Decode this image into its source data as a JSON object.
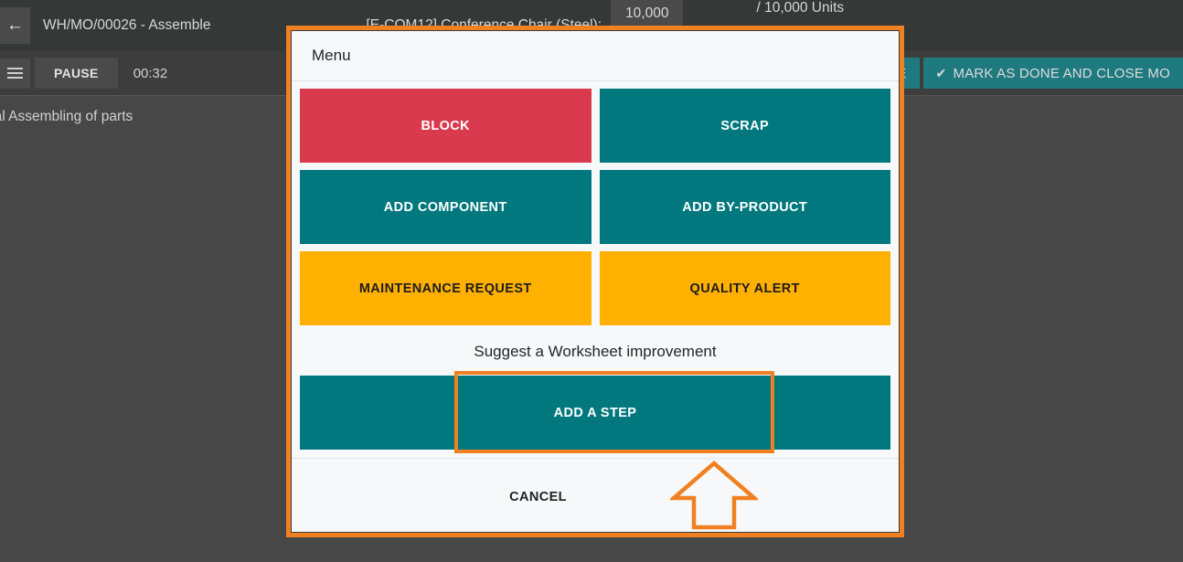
{
  "topbar": {
    "back_icon": "arrow-left-icon",
    "title": "WH/MO/00026 - Assemble",
    "product": "[E-COM12] Conference Chair (Steel):",
    "quantity": "10,000",
    "quantity_suffix": "/ 10,000 Units"
  },
  "subbar": {
    "menu_icon": "hamburger-menu-icon",
    "pause_label": "PAUSE",
    "timer": "00:32",
    "done_label": "DONE",
    "mark_done_close_label": "MARK AS DONE AND CLOSE MO",
    "check_icon": "check-icon"
  },
  "content": {
    "step_description": "nal Assembling of parts"
  },
  "modal": {
    "title": "Menu",
    "buttons": [
      {
        "label": "BLOCK",
        "style": "red",
        "name": "block-button"
      },
      {
        "label": "SCRAP",
        "style": "teal",
        "name": "scrap-button"
      },
      {
        "label": "ADD COMPONENT",
        "style": "teal",
        "name": "add-component-button"
      },
      {
        "label": "ADD BY-PRODUCT",
        "style": "teal",
        "name": "add-by-product-button"
      },
      {
        "label": "MAINTENANCE REQUEST",
        "style": "amber",
        "name": "maintenance-request-button"
      },
      {
        "label": "QUALITY ALERT",
        "style": "amber",
        "name": "quality-alert-button"
      }
    ],
    "suggest_label": "Suggest a Worksheet improvement",
    "add_step_label": "ADD A STEP",
    "cancel_label": "CANCEL"
  },
  "annotation": {
    "color": "#f08122",
    "arrow_icon": "up-arrow-annotation-icon",
    "target": "ADD A STEP"
  },
  "colors": {
    "accent_orange": "#f08122",
    "teal": "#00787e",
    "red": "#d93a4e",
    "amber": "#ffb000",
    "dark_bg": "#474747",
    "topbar_bg": "#343836",
    "modal_bg": "#f7f8fa"
  }
}
